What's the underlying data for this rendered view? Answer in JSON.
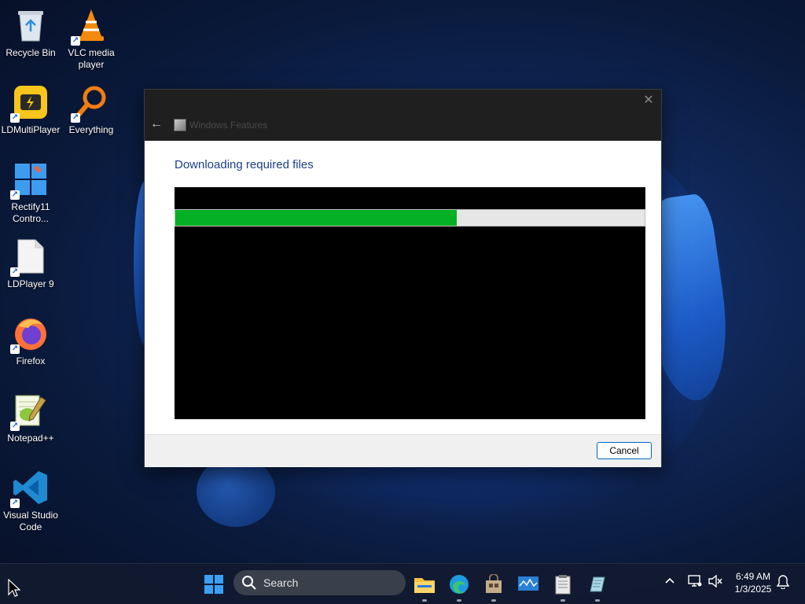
{
  "desktop": {
    "icons": [
      {
        "label": "Recycle Bin"
      },
      {
        "label": "VLC media player"
      },
      {
        "label": "LDMultiPlayer"
      },
      {
        "label": "Everything"
      },
      {
        "label": "Rectify11 Contro..."
      },
      {
        "label": "LDPlayer 9"
      },
      {
        "label": "Firefox"
      },
      {
        "label": "Notepad++"
      },
      {
        "label": "Visual Studio Code"
      }
    ]
  },
  "dialog": {
    "title": "Windows Features",
    "heading": "Downloading required files",
    "progress_percent": 60,
    "cancel_label": "Cancel",
    "close_glyph": "✕",
    "back_glyph": "←"
  },
  "taskbar": {
    "search_placeholder": "Search",
    "time": "6:49 AM",
    "date": "1/3/2025",
    "apps": [
      "start",
      "search",
      "file-explorer",
      "edge",
      "store",
      "monitor",
      "notepad",
      "disk-cleanup"
    ],
    "tray": [
      "chevron-up",
      "network",
      "sound",
      "notifications"
    ]
  },
  "colors": {
    "progress": "#06b025",
    "heading": "#1e3e8c",
    "accent": "#0067c0"
  }
}
